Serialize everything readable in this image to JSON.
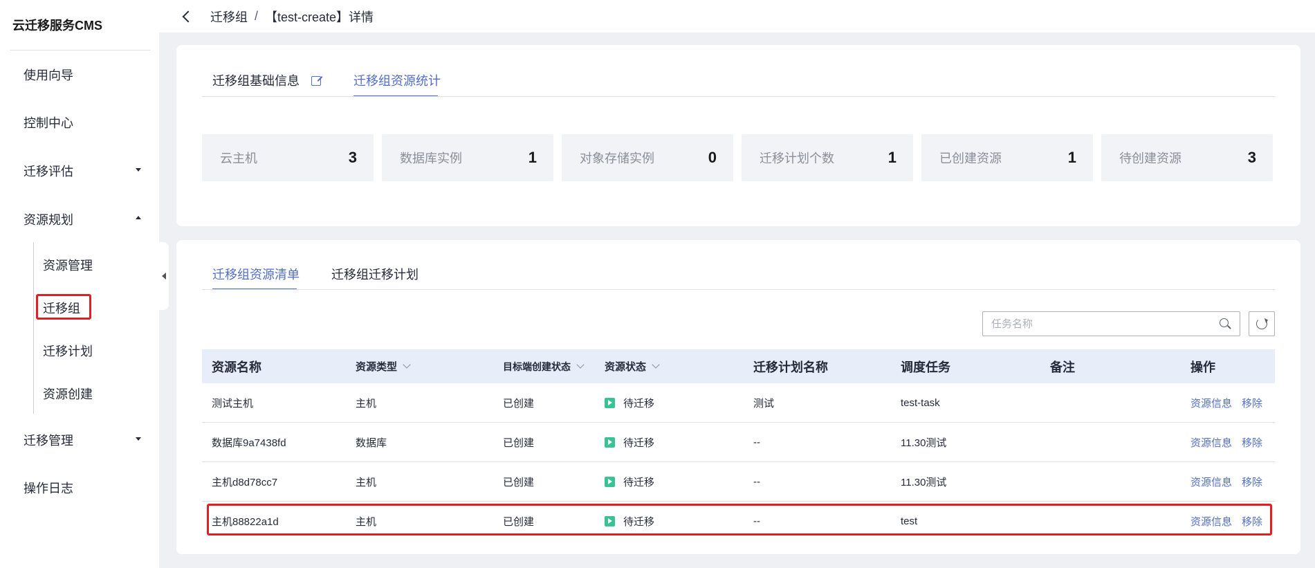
{
  "sidebar": {
    "title": "云迁移服务CMS",
    "items": [
      {
        "label": "使用向导"
      },
      {
        "label": "控制中心"
      },
      {
        "label": "迁移评估"
      },
      {
        "label": "资源规划"
      },
      {
        "label": "迁移管理"
      },
      {
        "label": "操作日志"
      }
    ],
    "sub_items": [
      {
        "label": "资源管理"
      },
      {
        "label": "迁移组"
      },
      {
        "label": "迁移计划"
      },
      {
        "label": "资源创建"
      }
    ]
  },
  "header": {
    "crumb_parent": "迁移组",
    "crumb_sep": "/",
    "crumb_current": "【test-create】详情"
  },
  "overview": {
    "tabs": [
      {
        "label": "迁移组基础信息"
      },
      {
        "label": "迁移组资源统计"
      }
    ],
    "stats": [
      {
        "label": "云主机",
        "value": "3"
      },
      {
        "label": "数据库实例",
        "value": "1"
      },
      {
        "label": "对象存储实例",
        "value": "0"
      },
      {
        "label": "迁移计划个数",
        "value": "1"
      },
      {
        "label": "已创建资源",
        "value": "1"
      },
      {
        "label": "待创建资源",
        "value": "3"
      }
    ]
  },
  "resources": {
    "tabs": [
      {
        "label": "迁移组资源清单"
      },
      {
        "label": "迁移组迁移计划"
      }
    ],
    "search_placeholder": "任务名称",
    "columns": [
      "资源名称",
      "资源类型",
      "目标端创建状态",
      "资源状态",
      "迁移计划名称",
      "调度任务",
      "备注",
      "操作"
    ],
    "rows": [
      {
        "name": "测试主机",
        "type": "主机",
        "create_status": "已创建",
        "status": "待迁移",
        "plan": "测试",
        "task": "test-task",
        "note": ""
      },
      {
        "name": "数据库9a7438fd",
        "type": "数据库",
        "create_status": "已创建",
        "status": "待迁移",
        "plan": "--",
        "task": "11.30测试",
        "note": ""
      },
      {
        "name": "主机d8d78cc7",
        "type": "主机",
        "create_status": "已创建",
        "status": "待迁移",
        "plan": "--",
        "task": "11.30测试",
        "note": ""
      },
      {
        "name": "主机88822a1d",
        "type": "主机",
        "create_status": "已创建",
        "status": "待迁移",
        "plan": "--",
        "task": "test",
        "note": ""
      }
    ],
    "actions": {
      "info": "资源信息",
      "remove": "移除"
    }
  },
  "colors": {
    "accent": "#526ecc",
    "highlight": "#e02020",
    "status_green": "#3ac295"
  }
}
